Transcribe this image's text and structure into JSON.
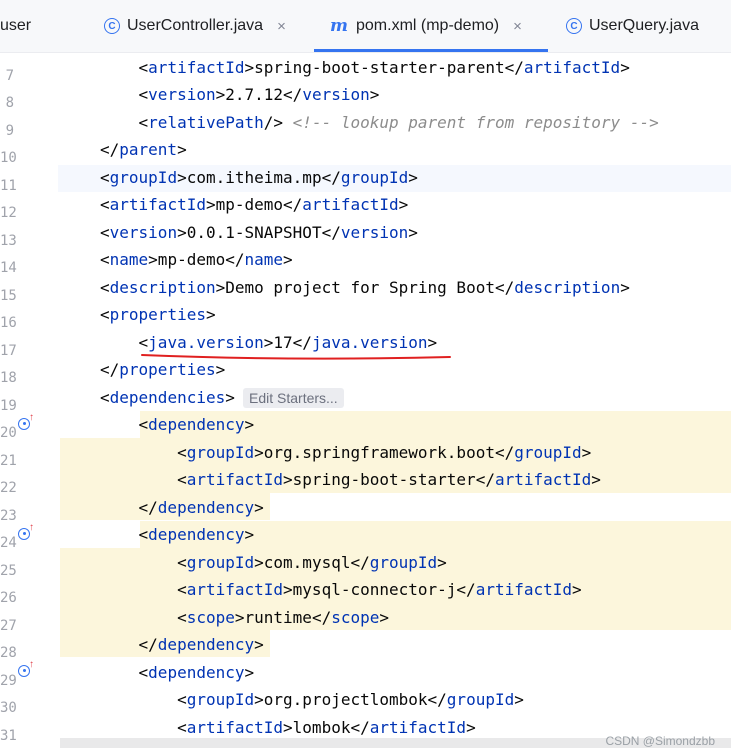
{
  "tabs": [
    {
      "label": "user",
      "icon": "none",
      "closable": false,
      "active": false
    },
    {
      "label": "UserController.java",
      "icon": "class-icon",
      "closable": true,
      "active": false
    },
    {
      "label": "pom.xml (mp-demo)",
      "icon": "maven-icon",
      "closable": true,
      "active": true
    },
    {
      "label": "UserQuery.java",
      "icon": "class-icon",
      "closable": false,
      "active": false
    }
  ],
  "tab_close_glyph": "×",
  "hint": "Edit Starters...",
  "watermark": "CSDN @Simondzbb",
  "accent_color": "#3574f0",
  "tag_color": "#0033b3",
  "lines": [
    {
      "num": "7",
      "text": "    <artifactId>spring-boot-starter-parent</artifactId>"
    },
    {
      "num": "8",
      "text": "    <version>2.7.12</version>"
    },
    {
      "num": "9",
      "text": "    <relativePath/> <!-- lookup parent from repository -->"
    },
    {
      "num": "10",
      "text": "</parent>"
    },
    {
      "num": "11",
      "text": "<groupId>com.itheima.mp</groupId>"
    },
    {
      "num": "12",
      "text": "<artifactId>mp-demo</artifactId>"
    },
    {
      "num": "13",
      "text": "<version>0.0.1-SNAPSHOT</version>"
    },
    {
      "num": "14",
      "text": "<name>mp-demo</name>"
    },
    {
      "num": "15",
      "text": "<description>Demo project for Spring Boot</description>"
    },
    {
      "num": "16",
      "text": "<properties>"
    },
    {
      "num": "17",
      "text": "    <java.version>17</java.version>"
    },
    {
      "num": "18",
      "text": "</properties>"
    },
    {
      "num": "19",
      "text": "<dependencies>"
    },
    {
      "num": "20",
      "text": "    <dependency>"
    },
    {
      "num": "21",
      "text": "        <groupId>org.springframework.boot</groupId>"
    },
    {
      "num": "22",
      "text": "        <artifactId>spring-boot-starter</artifactId>"
    },
    {
      "num": "23",
      "text": "    </dependency>"
    },
    {
      "num": "24",
      "text": "    <dependency>"
    },
    {
      "num": "25",
      "text": "        <groupId>com.mysql</groupId>"
    },
    {
      "num": "26",
      "text": "        <artifactId>mysql-connector-j</artifactId>"
    },
    {
      "num": "27",
      "text": "        <scope>runtime</scope>"
    },
    {
      "num": "28",
      "text": "    </dependency>"
    },
    {
      "num": "29",
      "text": "    <dependency>"
    },
    {
      "num": "30",
      "text": "        <groupId>org.projectlombok</groupId>"
    },
    {
      "num": "31",
      "text": "        <artifactId>lombok</artifactId>"
    }
  ]
}
